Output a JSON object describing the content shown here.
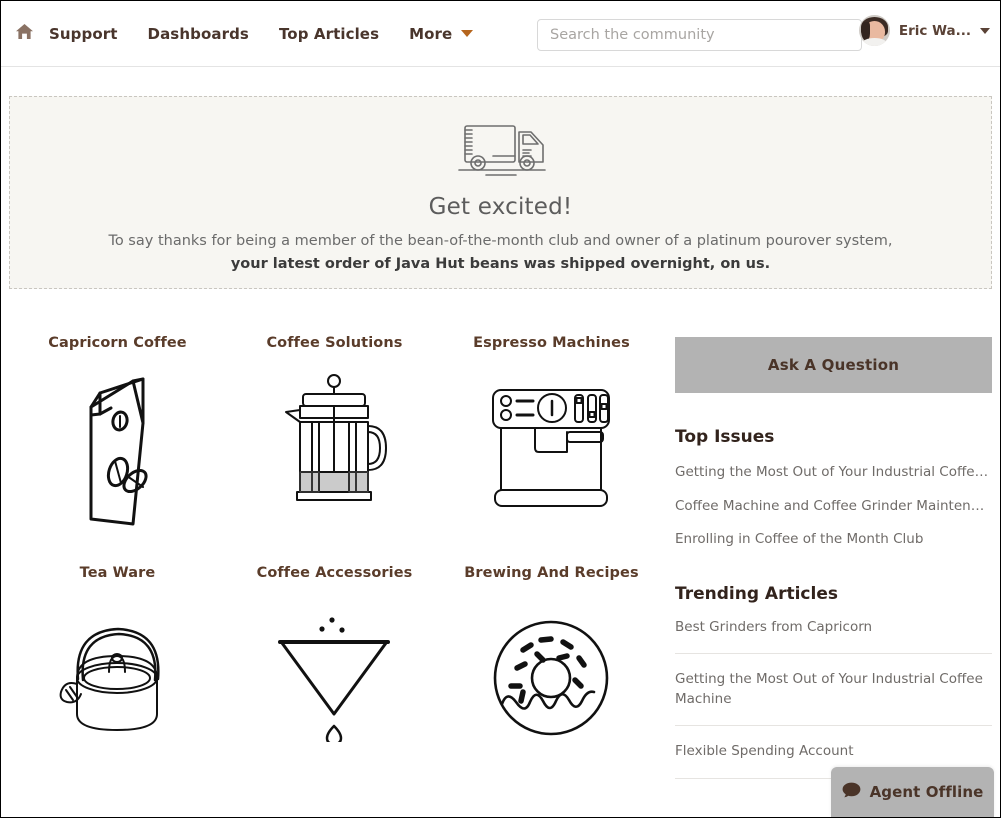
{
  "header": {
    "home_icon": "home-icon",
    "nav": [
      {
        "label": "Support",
        "has_caret": false
      },
      {
        "label": "Dashboards",
        "has_caret": false
      },
      {
        "label": "Top Articles",
        "has_caret": false
      },
      {
        "label": "More",
        "has_caret": true
      }
    ],
    "search": {
      "placeholder": "Search the community",
      "value": ""
    },
    "user": {
      "name": "Eric Wa...",
      "avatar_icon": "user-avatar"
    }
  },
  "banner": {
    "icon": "delivery-truck-icon",
    "title": "Get excited!",
    "line1": "To say thanks for being a member of the bean-of-the-month club and owner of a platinum pourover system,",
    "line2": "your latest order of Java Hut beans was shipped overnight, on us."
  },
  "categories": [
    {
      "title": "Capricorn Coffee",
      "icon": "coffee-bag-icon"
    },
    {
      "title": "Coffee Solutions",
      "icon": "french-press-icon"
    },
    {
      "title": "Espresso Machines",
      "icon": "espresso-machine-icon"
    },
    {
      "title": "Tea Ware",
      "icon": "tea-kettle-icon"
    },
    {
      "title": "Coffee Accessories",
      "icon": "pourover-dripper-icon"
    },
    {
      "title": "Brewing And Recipes",
      "icon": "donut-icon"
    }
  ],
  "sidebar": {
    "ask_button_label": "Ask A Question",
    "top_issues": {
      "heading": "Top Issues",
      "items": [
        "Getting the Most Out of Your Industrial Coffee Mach...",
        "Coffee Machine and Coffee Grinder Maintenance",
        "Enrolling in Coffee of the Month Club"
      ]
    },
    "trending": {
      "heading": "Trending Articles",
      "items": [
        "Best Grinders from Capricorn",
        "Getting the Most Out of Your Industrial Coffee Machine",
        "Flexible Spending Account"
      ]
    }
  },
  "chat_widget": {
    "label": "Agent Offline",
    "icon": "chat-bubble-icon"
  },
  "colors": {
    "nav_text": "#49352c",
    "accent_caret": "#b5651d",
    "category_title": "#5a3c2a",
    "banner_bg": "#f7f6f2",
    "banner_border": "#c9c6c0",
    "button_bg": "#b3b3b3",
    "button_text": "#4a3428",
    "link_text": "#6f6b68"
  }
}
